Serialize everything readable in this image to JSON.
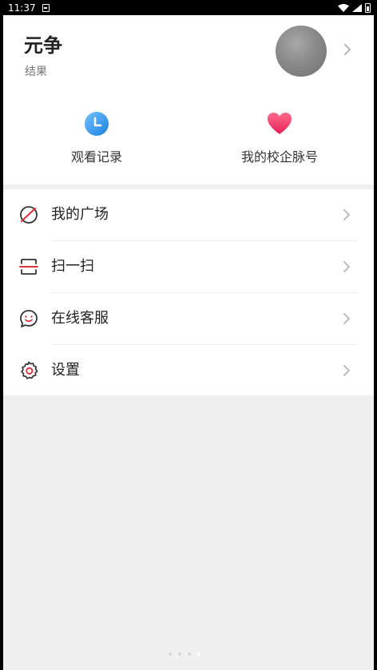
{
  "status_bar": {
    "time": "11:37"
  },
  "profile": {
    "name": "元争",
    "subtitle": "结果"
  },
  "quick_actions": [
    {
      "label": "观看记录",
      "icon": "clock-icon"
    },
    {
      "label": "我的校企脉号",
      "icon": "heart-icon"
    }
  ],
  "menu": [
    {
      "label": "我的广场",
      "icon": "planet-icon"
    },
    {
      "label": "扫一扫",
      "icon": "scan-icon"
    },
    {
      "label": "在线客服",
      "icon": "smile-chat-icon"
    },
    {
      "label": "设置",
      "icon": "gear-icon"
    }
  ],
  "colors": {
    "accent_red": "#e0343a",
    "clock_blue": "#2f8fe6",
    "heart_pink": "#f0386b"
  }
}
